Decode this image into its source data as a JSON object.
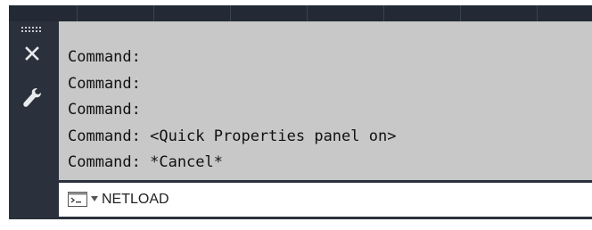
{
  "command_line": {
    "history": [
      "Command:",
      "Command:",
      "Command:",
      "Command: <Quick Properties panel on>",
      "Command: *Cancel*"
    ],
    "input_value": "NETLOAD"
  },
  "icons": {
    "grip": "grip-dots-icon",
    "close": "close-icon",
    "customize": "wrench-icon",
    "prompt": "command-prompt-icon",
    "dropdown": "chevron-down-icon"
  },
  "colors": {
    "panel_bg": "#2a313c",
    "history_bg": "#c8c8c8",
    "input_bg": "#ffffff",
    "text": "#111111"
  }
}
